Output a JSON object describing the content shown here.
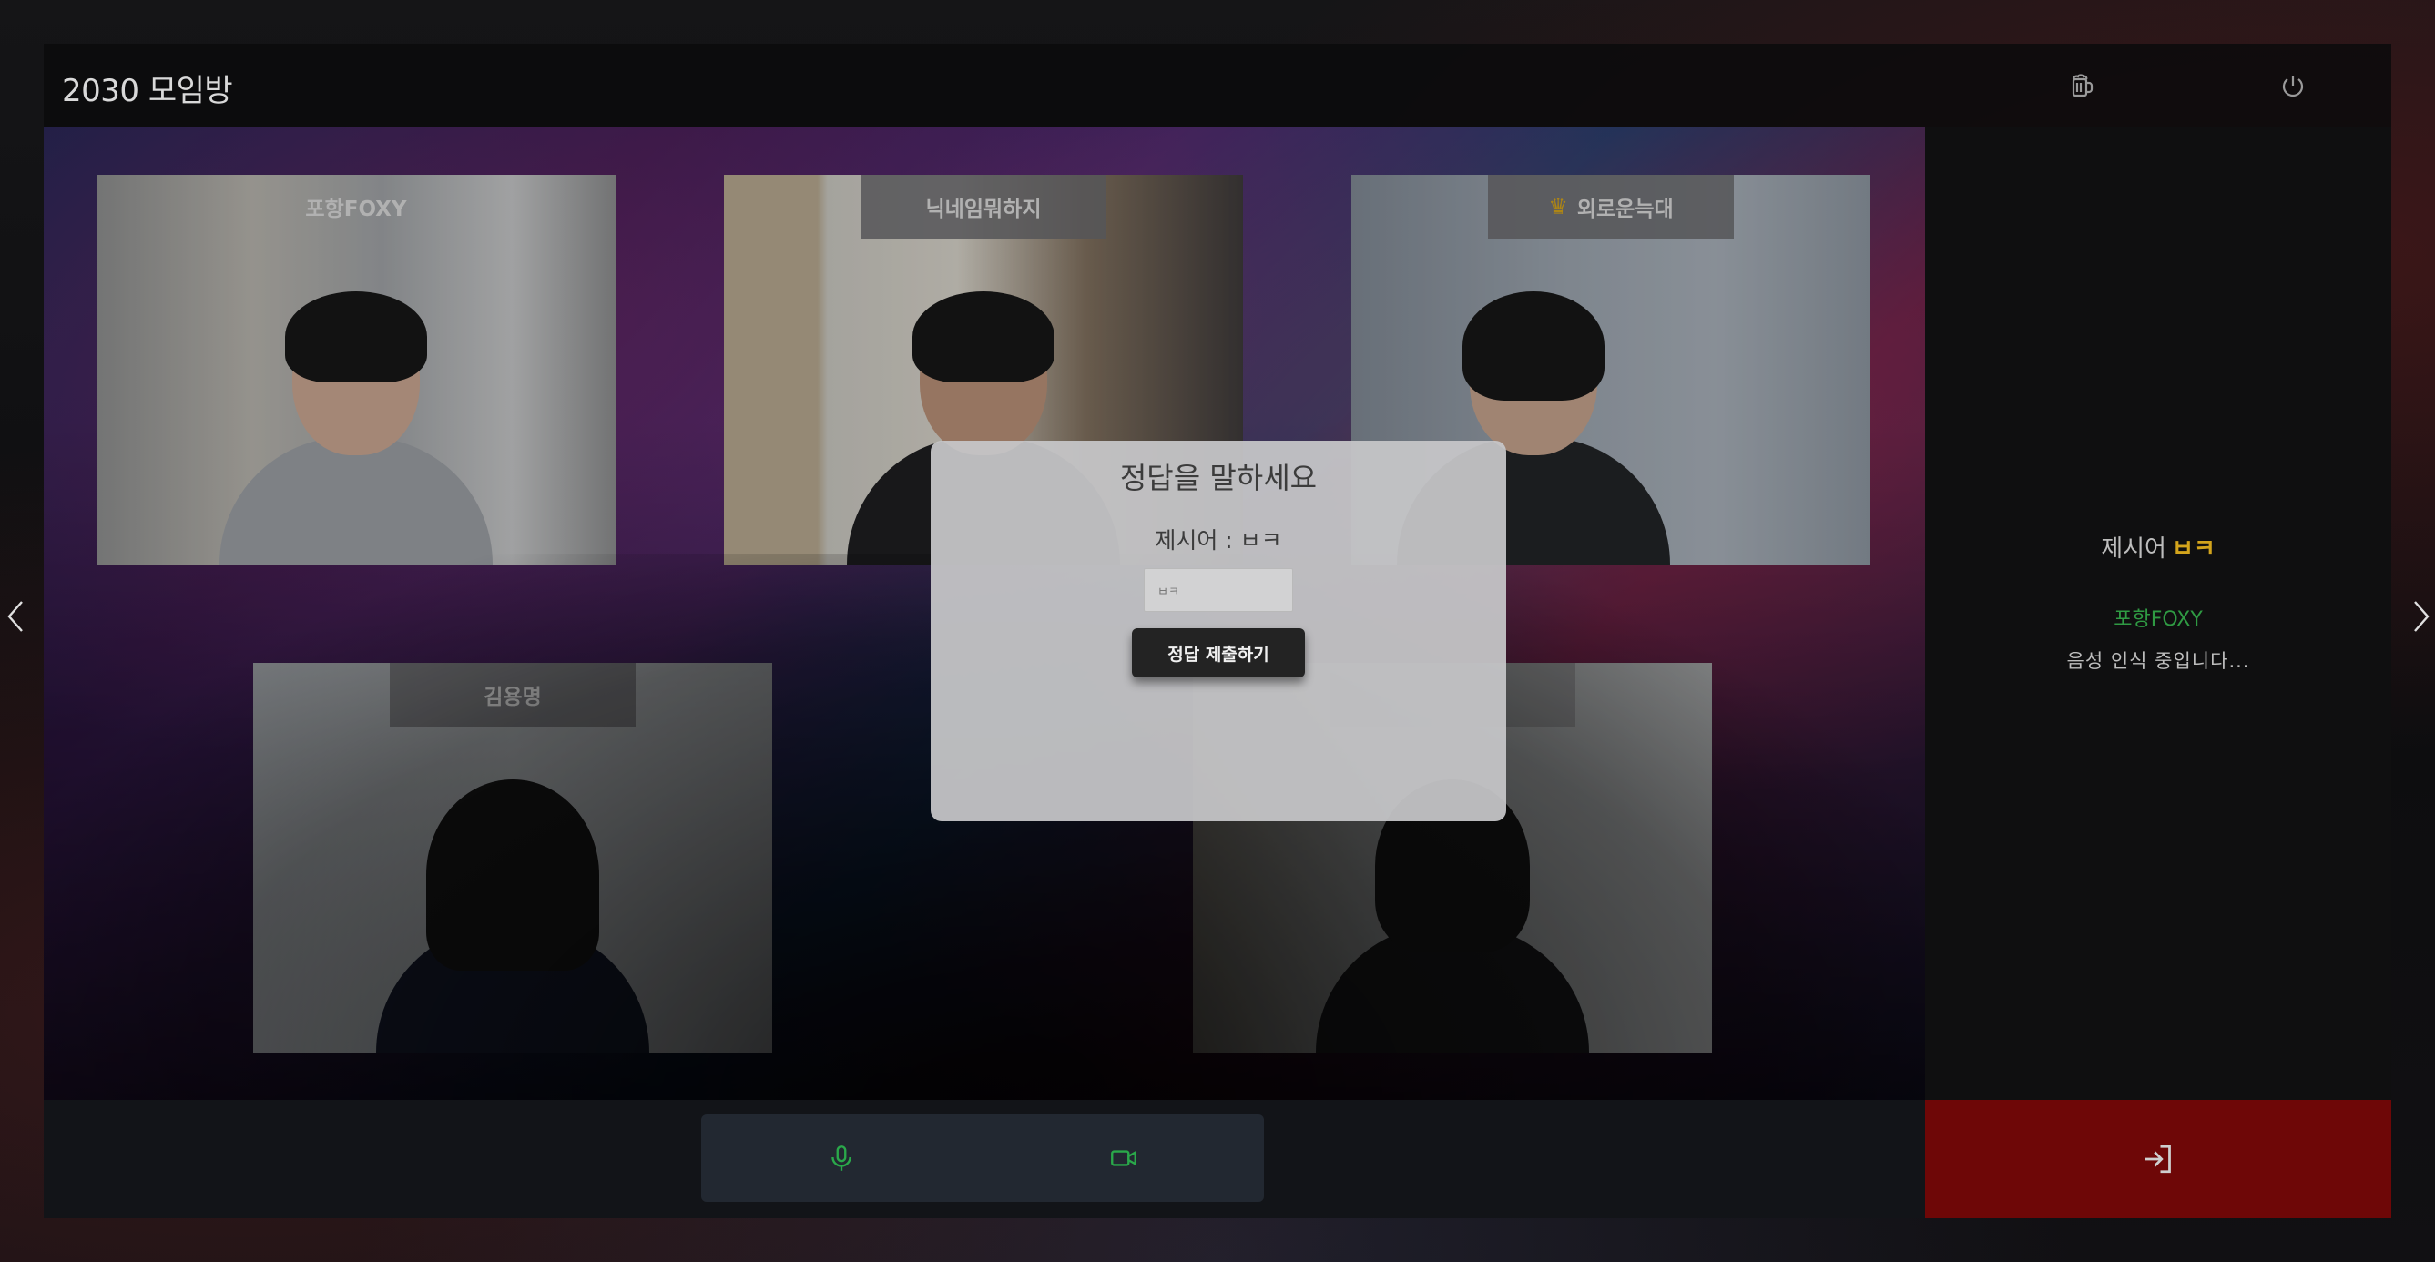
{
  "app": {
    "title": "2030 모임방"
  },
  "header": {
    "icons": [
      "beer-icon",
      "power-icon"
    ]
  },
  "participants": [
    {
      "name": "포항FOXY",
      "host": false
    },
    {
      "name": "닉네임뭐하지",
      "host": false
    },
    {
      "name": "외로운늑대",
      "host": true
    },
    {
      "name": "김용명",
      "host": false
    },
    {
      "name": "",
      "host": false
    }
  ],
  "modal": {
    "title": "정답을 말하세요",
    "hint": "제시어 : ㅂㅋ",
    "input_value": "ㅂㅋ",
    "submit_label": "정답 제출하기"
  },
  "side_panel": {
    "hint_label": "제시어",
    "hint_value": "ㅂㅋ",
    "speaker": "포항FOXY",
    "status": "음성 인식 중입니다..."
  },
  "controls": {
    "mic": "mic-icon",
    "camera": "video-icon",
    "exit": "exit-icon"
  },
  "colors": {
    "accent_green": "#2aa84a",
    "hint_gold": "#d3a41c",
    "exit_red": "#6e0707"
  }
}
